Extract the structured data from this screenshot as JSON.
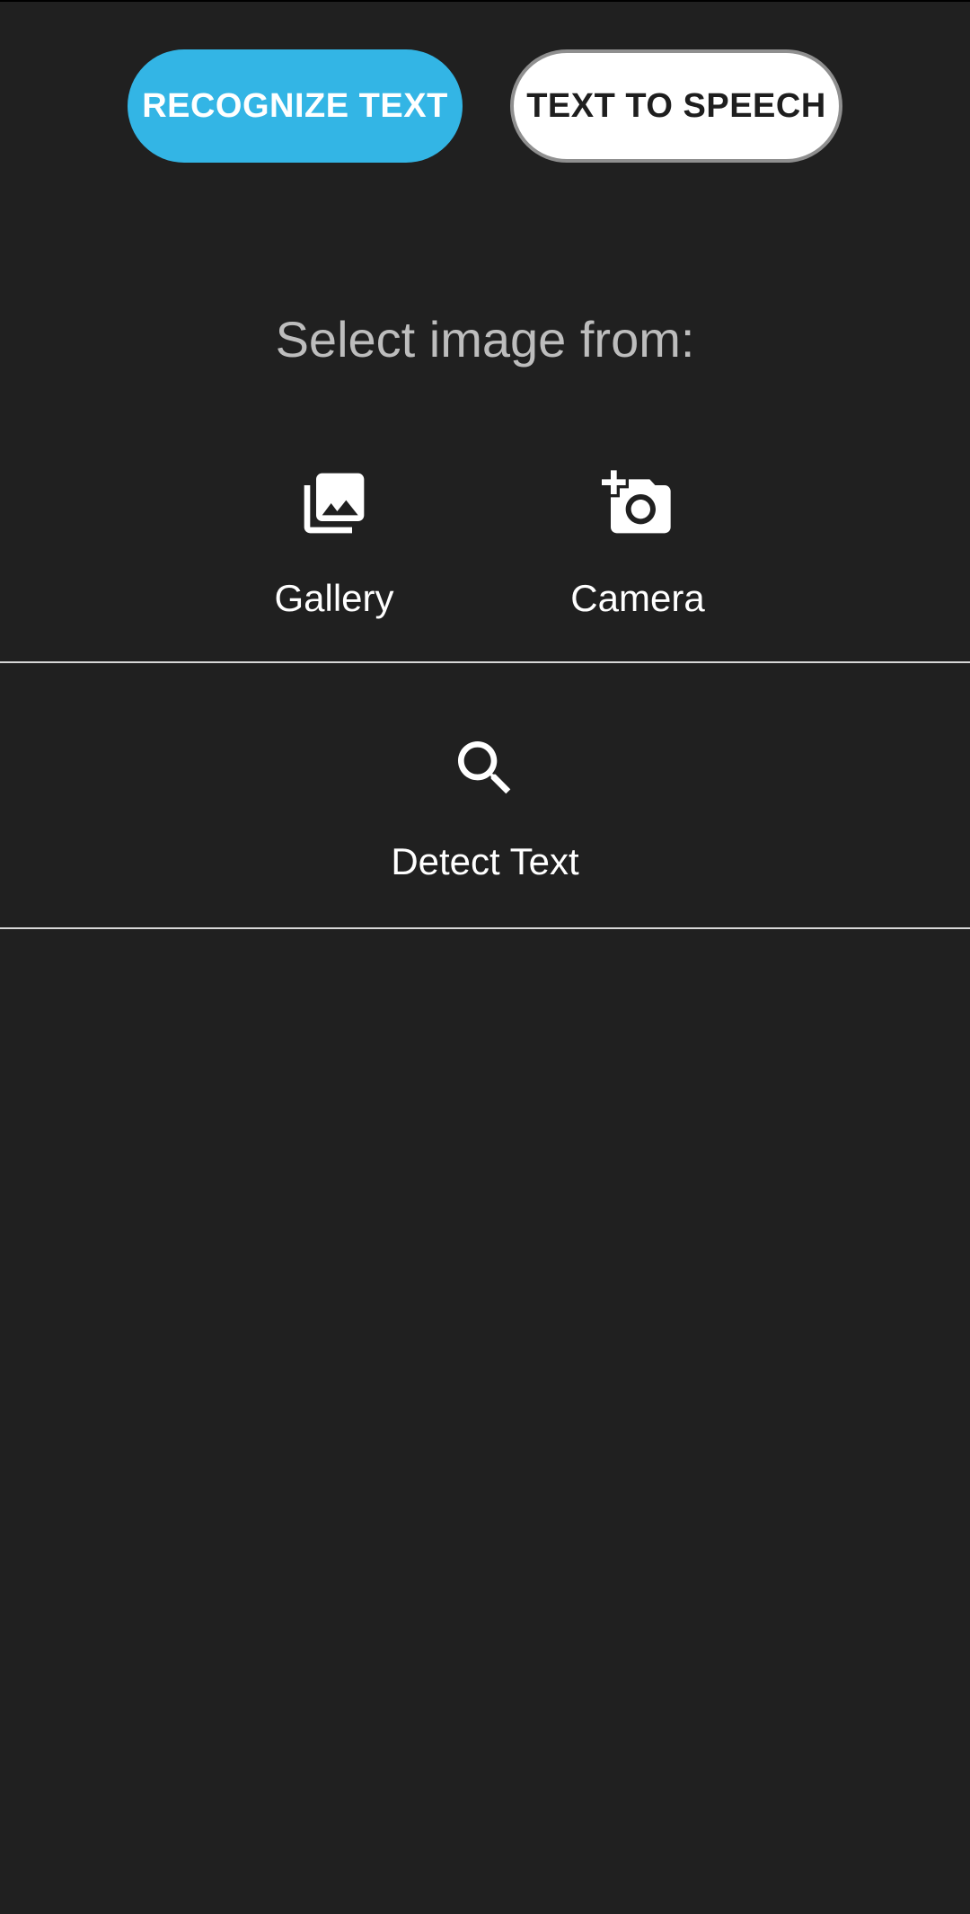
{
  "tabs": {
    "recognize_label": "RECOGNIZE TEXT",
    "tts_label": "TEXT TO SPEECH"
  },
  "source": {
    "prompt": "Select image from:",
    "gallery_label": "Gallery",
    "gallery_icon": "photo-library-icon",
    "camera_label": "Camera",
    "camera_icon": "add-a-photo-icon"
  },
  "detect": {
    "label": "Detect Text",
    "icon": "search-icon"
  },
  "colors": {
    "background": "#202020",
    "accent": "#33b5e5",
    "text": "#ffffff",
    "muted_text": "#bdbdbd"
  }
}
